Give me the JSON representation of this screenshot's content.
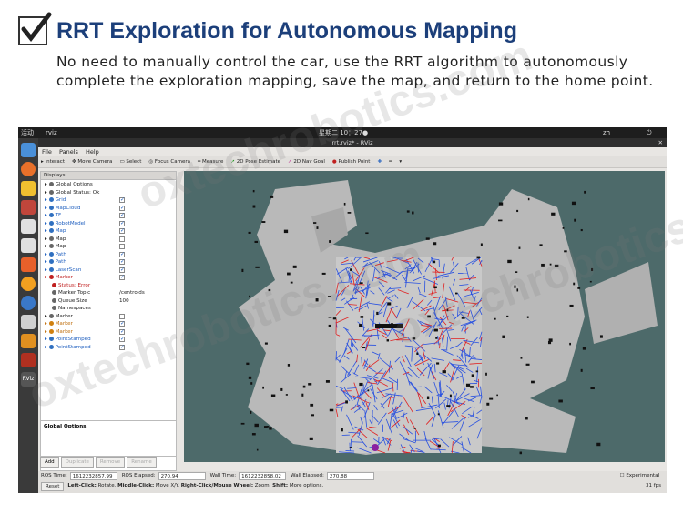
{
  "header": {
    "title": "RRT Exploration for Autonomous Mapping",
    "description": "No need to manually control the car, use the RRT algorithm to autonomously complete the exploration mapping, save the map, and return to the home point."
  },
  "os_topbar": {
    "activities": "活动",
    "app": "rviz",
    "clock": "星期二 10：27●",
    "lang": "zh"
  },
  "window": {
    "title": "rrt.rviz* - RViz",
    "menu": [
      "File",
      "Panels",
      "Help"
    ],
    "toolbar": [
      "Interact",
      "Move Camera",
      "Select",
      "Focus Camera",
      "Measure",
      "2D Pose Estimate",
      "2D Nav Goal",
      "Publish Point"
    ]
  },
  "displays": {
    "header": "Displays",
    "rows": [
      {
        "label": "Global Options",
        "color": "",
        "check": ""
      },
      {
        "label": "Global Status: Ok",
        "color": "",
        "check": ""
      },
      {
        "label": "Grid",
        "color": "blue",
        "check": "on"
      },
      {
        "label": "MapCloud",
        "color": "blue",
        "check": "on"
      },
      {
        "label": "TF",
        "color": "blue",
        "check": "on"
      },
      {
        "label": "RobotModel",
        "color": "blue",
        "check": "on"
      },
      {
        "label": "Map",
        "color": "blue",
        "check": "on"
      },
      {
        "label": "Map",
        "color": "",
        "check": "off"
      },
      {
        "label": "Map",
        "color": "",
        "check": "off"
      },
      {
        "label": "Path",
        "color": "blue",
        "check": "on"
      },
      {
        "label": "Path",
        "color": "blue",
        "check": "on"
      },
      {
        "label": "LaserScan",
        "color": "blue",
        "check": "on"
      },
      {
        "label": "Marker",
        "color": "red",
        "check": "on"
      },
      {
        "label": "Status: Error",
        "color": "red",
        "check": ""
      },
      {
        "label": "Marker Topic",
        "color": "",
        "check": "",
        "value": "/centroids"
      },
      {
        "label": "Queue Size",
        "color": "",
        "check": "",
        "value": "100"
      },
      {
        "label": "Namespaces",
        "color": "",
        "check": ""
      },
      {
        "label": "Marker",
        "color": "",
        "check": "off"
      },
      {
        "label": "Marker",
        "color": "orange",
        "check": "on"
      },
      {
        "label": "Marker",
        "color": "orange",
        "check": "on"
      },
      {
        "label": "PointStamped",
        "color": "blue",
        "check": "on"
      },
      {
        "label": "PointStamped",
        "color": "blue",
        "check": "on"
      }
    ],
    "props_title": "Global Options",
    "buttons": [
      "Add",
      "Duplicate",
      "Remove",
      "Rename"
    ]
  },
  "time_panel": {
    "title": "Time",
    "ros_time_label": "ROS Time:",
    "ros_time": "1612232857.99",
    "ros_elapsed_label": "ROS Elapsed:",
    "ros_elapsed": "270.94",
    "wall_time_label": "Wall Time:",
    "wall_time": "1612232858.02",
    "wall_elapsed_label": "Wall Elapsed:",
    "wall_elapsed": "270.88",
    "experimental": "Experimental",
    "reset": "Reset",
    "hint_1": "Left-Click:",
    "hint_2": " Rotate. ",
    "hint_3": "Middle-Click:",
    "hint_4": " Move X/Y. ",
    "hint_5": "Right-Click/Mouse Wheel:",
    "hint_6": " Zoom. ",
    "hint_7": "Shift:",
    "hint_8": " More options.",
    "fps": "31 fps"
  },
  "colors": {
    "title": "#1c3f7a",
    "viewport_bg": "#4d6a6a",
    "rrt_blue": "#2850e0",
    "rrt_red": "#e02020"
  }
}
